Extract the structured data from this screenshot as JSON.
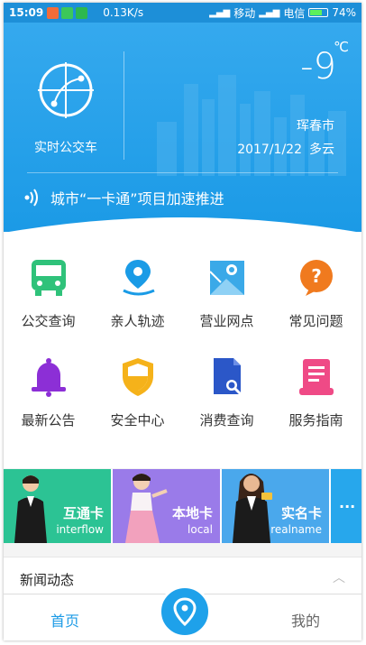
{
  "status_bar": {
    "time": "15:09",
    "speed": "0.13K/s",
    "carrier1": "移动",
    "carrier2": "电信",
    "battery": "74%",
    "battery_level": 0.74
  },
  "header": {
    "realtime_bus_label": "实时公交车",
    "temperature": "-9",
    "temperature_unit": "℃",
    "city": "珲春市",
    "date": "2017/1/22",
    "weather": "多云",
    "news_ticker": "城市“一卡通”项目加速推进"
  },
  "grid": {
    "items": [
      {
        "label": "公交查询",
        "icon": "bus-icon",
        "color": "#2fc27a"
      },
      {
        "label": "亲人轨迹",
        "icon": "location-pin-icon",
        "color": "#1a9be6"
      },
      {
        "label": "营业网点",
        "icon": "map-icon",
        "color": "#3aa9e8"
      },
      {
        "label": "常见问题",
        "icon": "question-icon",
        "color": "#f07a1e"
      },
      {
        "label": "最新公告",
        "icon": "bell-icon",
        "color": "#8c2fd6"
      },
      {
        "label": "安全中心",
        "icon": "shield-icon",
        "color": "#f5b21a"
      },
      {
        "label": "消费查询",
        "icon": "document-search-icon",
        "color": "#2b57c8"
      },
      {
        "label": "服务指南",
        "icon": "guide-book-icon",
        "color": "#ef4a86"
      }
    ]
  },
  "cards": [
    {
      "title": "互通卡",
      "subtitle": "interflow",
      "color": "#2cc394"
    },
    {
      "title": "本地卡",
      "subtitle": "local",
      "color": "#9a7be9"
    },
    {
      "title": "实名卡",
      "subtitle": "realname",
      "color": "#4aa8ec"
    }
  ],
  "more_label": "···",
  "news_section": {
    "title": "新闻动态",
    "chevron": "︿"
  },
  "bottom_nav": {
    "home": "首页",
    "mine": "我的"
  },
  "colors": {
    "primary": "#1d9be6",
    "header_gradient_top": "#35a9ee"
  }
}
